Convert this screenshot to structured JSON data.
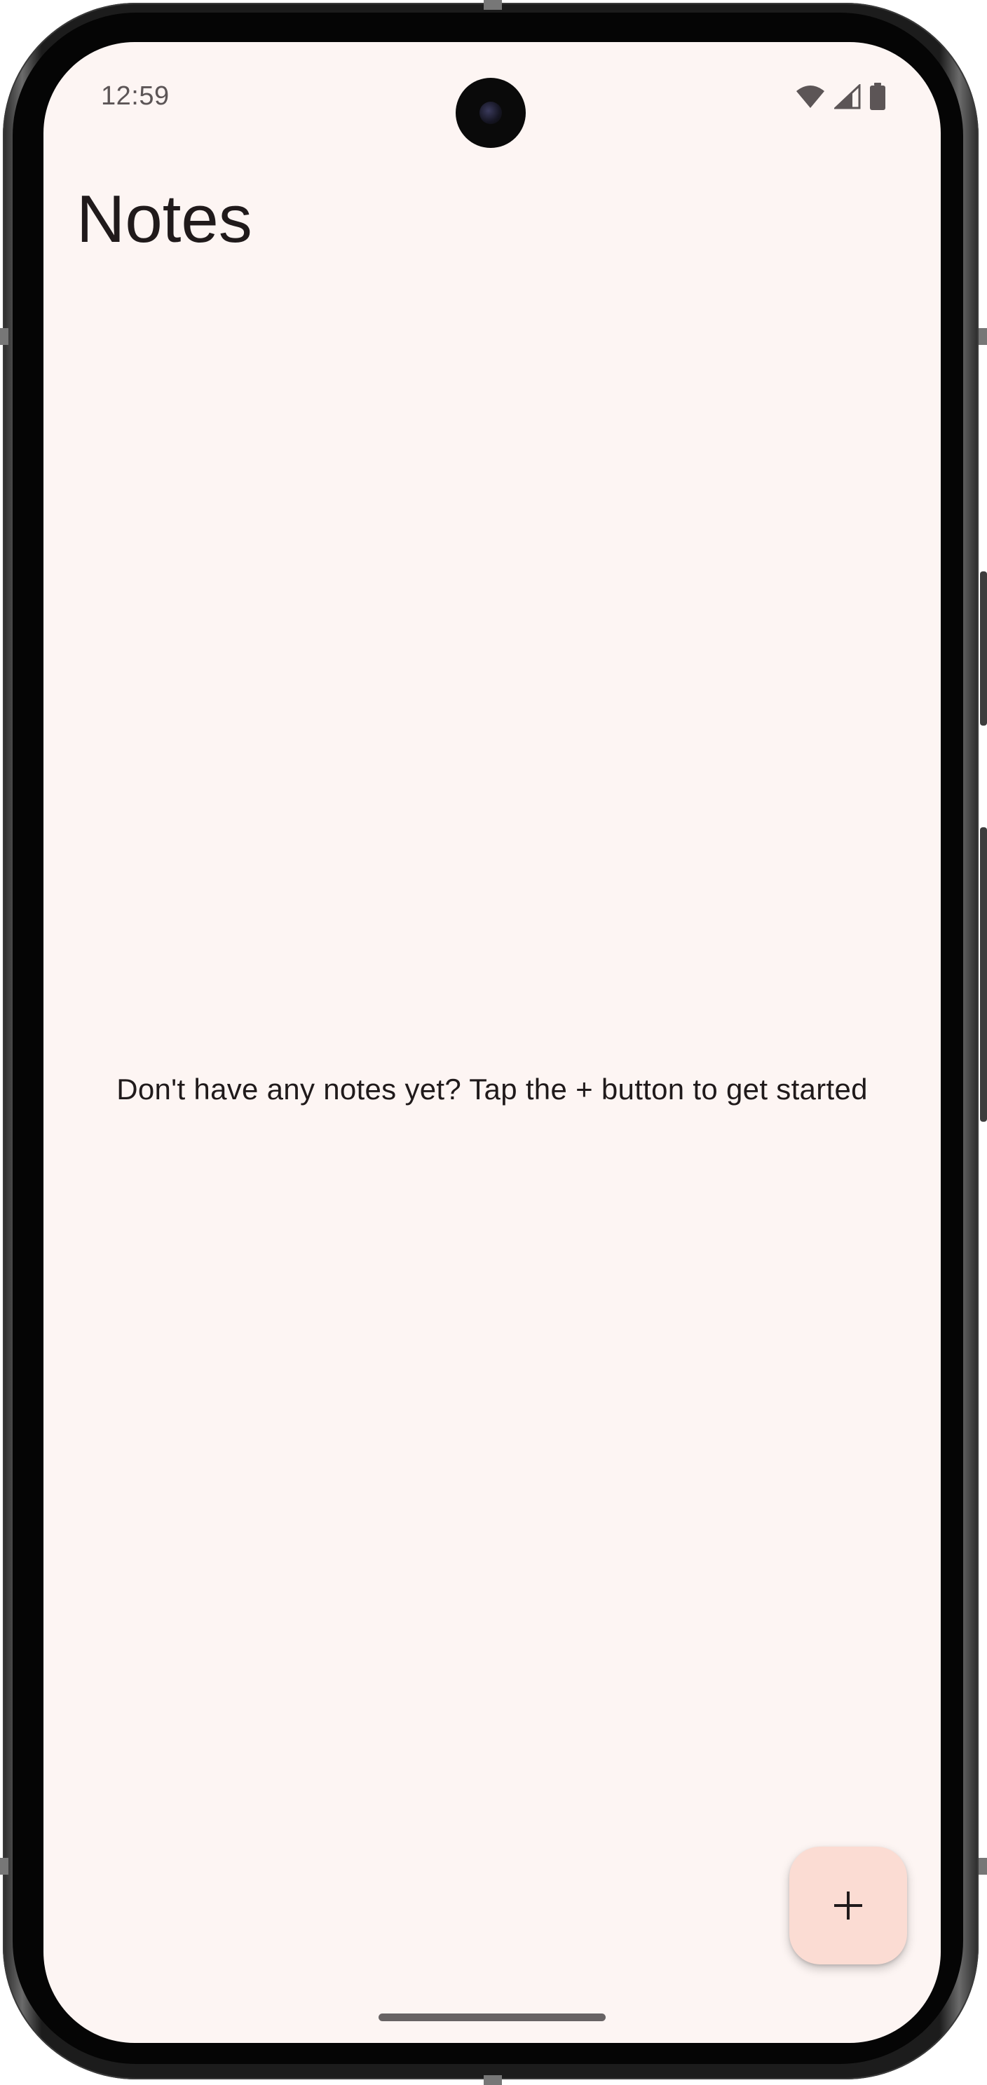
{
  "status_bar": {
    "time": "12:59",
    "icons": [
      "wifi-icon",
      "cellular-signal-icon",
      "battery-icon"
    ]
  },
  "app_bar": {
    "title": "Notes"
  },
  "empty_state": {
    "message": "Don't have any notes yet? Tap the + button to get started"
  },
  "fab": {
    "icon": "plus-icon"
  },
  "colors": {
    "background": "#fdf5f3",
    "fab_background": "#fbdcd3",
    "text_primary": "#201a1b",
    "status_text": "#5c5556"
  }
}
